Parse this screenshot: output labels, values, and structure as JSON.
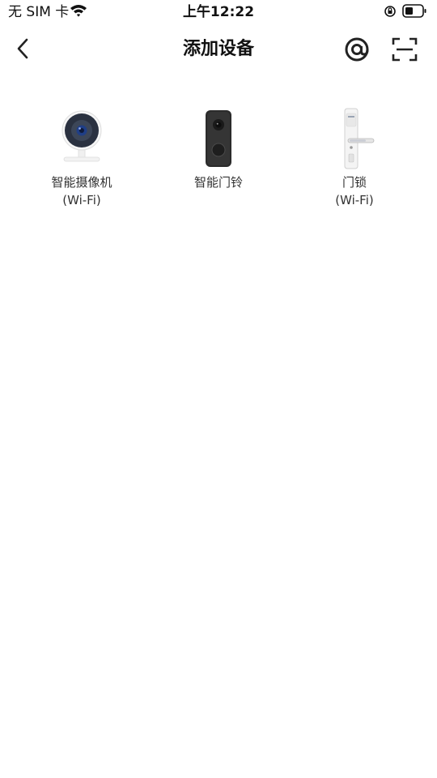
{
  "status_bar": {
    "carrier": "无 SIM 卡",
    "time": "上午12:22"
  },
  "nav": {
    "title": "添加设备",
    "back_icon": "chevron-left-icon",
    "at_icon": "at-sign-icon",
    "scan_icon": "scan-icon"
  },
  "devices": [
    {
      "name": "智能摄像机",
      "sub": "(Wi-Fi)",
      "icon": "camera-icon"
    },
    {
      "name": "智能门铃",
      "sub": "",
      "icon": "doorbell-icon"
    },
    {
      "name": "门锁",
      "sub": "(Wi-Fi)",
      "icon": "door-lock-icon"
    }
  ],
  "colors": {
    "text": "#111111",
    "label": "#333333",
    "background": "#ffffff"
  }
}
